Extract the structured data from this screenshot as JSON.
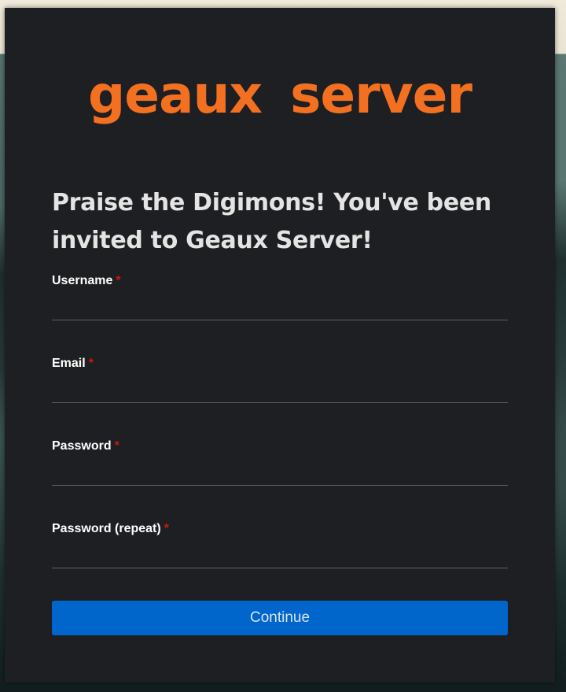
{
  "brand": {
    "logo_text": "geaux server",
    "accent_color": "#f37021"
  },
  "page": {
    "heading": "Praise the Digimons! You've been invited to Geaux Server!"
  },
  "form": {
    "required_marker": "*",
    "fields": [
      {
        "label": "Username",
        "value": "",
        "type": "text"
      },
      {
        "label": "Email",
        "value": "",
        "type": "email"
      },
      {
        "label": "Password",
        "value": "",
        "type": "password"
      },
      {
        "label": "Password (repeat)",
        "value": "",
        "type": "password"
      }
    ],
    "submit_label": "Continue",
    "submit_color": "#0066cc",
    "required_color": "#c9190b"
  }
}
